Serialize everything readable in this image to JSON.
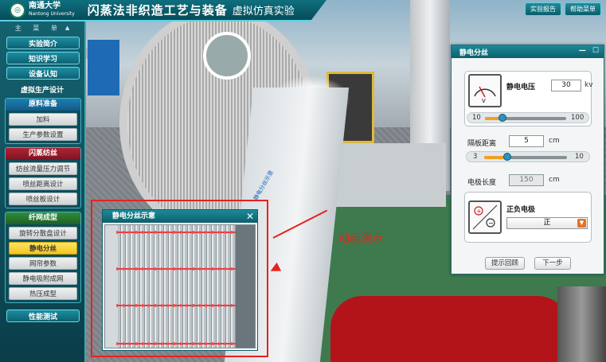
{
  "header": {
    "logo_cn": "南通大学",
    "logo_en": "Nantong University",
    "title": "闪蒸法非织造工艺与装备",
    "subtitle": "虚拟仿真实验",
    "report_btn": "实验报告",
    "help_btn": "帮助菜单"
  },
  "sidebar": {
    "menu_title": "主 菜 单",
    "top_items": [
      "实验简介",
      "知识学习",
      "设备认知"
    ],
    "section_label": "虚拟生产设计",
    "groups": [
      {
        "title": "原料准备",
        "items": [
          "加料",
          "生产参数设置"
        ]
      },
      {
        "title": "闪蒸纺丝",
        "items": [
          "纺丝流量压力调节",
          "喷丝距离设计",
          "喷丝板设计"
        ]
      },
      {
        "title": "纤网成型",
        "items": [
          "旋转分散盘设计",
          "静电分丝",
          "网帘参数",
          "静电吸附成网",
          "热压成型"
        ]
      }
    ],
    "active_item": "静电分丝",
    "bottom_item": "性能测试"
  },
  "panel": {
    "title": "静电分丝",
    "voltage": {
      "label": "静电电压",
      "value": "30",
      "unit": "kv",
      "min": "10",
      "max": "100",
      "fraction": 0.22
    },
    "distance": {
      "label": "隔板距离",
      "value": "5",
      "unit": "cm",
      "min": "3",
      "max": "10",
      "fraction": 0.28
    },
    "length": {
      "label": "电极长度",
      "value": "150",
      "unit": "cm"
    },
    "electrode": {
      "label": "正负电极",
      "selected": "正"
    },
    "hint_btn": "提示回顾",
    "next_btn": "下一步"
  },
  "popup": {
    "title": "静电分丝示意",
    "close": "✕"
  },
  "annotation": {
    "text": "动画演示"
  },
  "scene": {
    "tilted_text": "静电分丝示意"
  }
}
